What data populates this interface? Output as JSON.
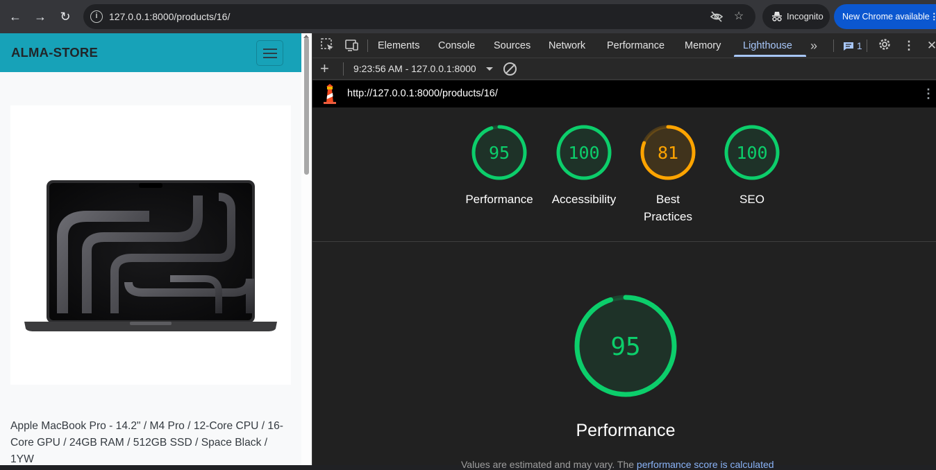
{
  "browser": {
    "url": "127.0.0.1:8000/products/16/",
    "incognito_label": "Incognito",
    "update_label": "New Chrome available"
  },
  "site": {
    "brand": "ALMA-STORE",
    "product_title": "Apple MacBook Pro - 14.2\" / M4 Pro / 12-Core CPU / 16-Core GPU / 24GB RAM / 512GB SSD / Space Black / 1YW"
  },
  "devtools": {
    "tabs": [
      "Elements",
      "Console",
      "Sources",
      "Network",
      "Performance",
      "Memory",
      "Lighthouse"
    ],
    "active_tab": "Lighthouse",
    "issues_count": "1",
    "report_selector": "9:23:56 AM - 127.0.0.1:8000",
    "report_url": "http://127.0.0.1:8000/products/16/"
  },
  "lighthouse": {
    "scores": [
      {
        "label": "Performance",
        "score": 95,
        "color": "#0cce6b"
      },
      {
        "label": "Accessibility",
        "score": 100,
        "color": "#0cce6b"
      },
      {
        "label": "Best\nPractices",
        "score": 81,
        "color": "#ffa400"
      },
      {
        "label": "SEO",
        "score": 100,
        "color": "#0cce6b"
      }
    ],
    "main": {
      "label": "Performance",
      "score": 95,
      "color": "#0cce6b"
    },
    "note_prefix": "Values are estimated and may vary. The ",
    "note_link": "performance score is calculated"
  }
}
